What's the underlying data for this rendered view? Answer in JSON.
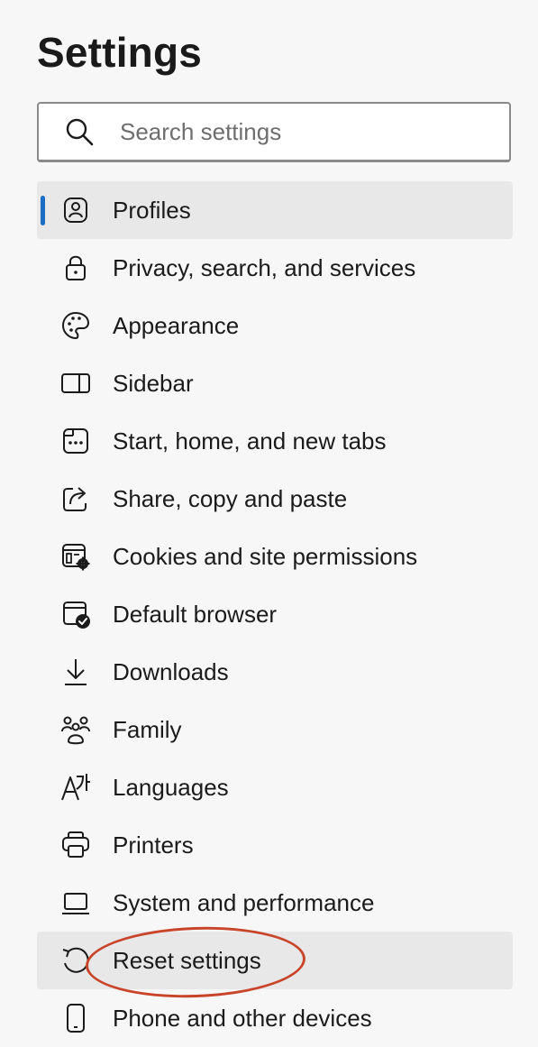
{
  "header": {
    "title": "Settings"
  },
  "search": {
    "placeholder": "Search settings",
    "icon": "search-icon"
  },
  "nav": {
    "items": [
      {
        "label": "Profiles",
        "icon": "profile-icon",
        "state": "selected"
      },
      {
        "label": "Privacy, search, and services",
        "icon": "lock-icon"
      },
      {
        "label": "Appearance",
        "icon": "palette-icon"
      },
      {
        "label": "Sidebar",
        "icon": "sidebar-icon"
      },
      {
        "label": "Start, home, and new tabs",
        "icon": "home-tabs-icon"
      },
      {
        "label": "Share, copy and paste",
        "icon": "share-icon"
      },
      {
        "label": "Cookies and site permissions",
        "icon": "cookies-permissions-icon"
      },
      {
        "label": "Default browser",
        "icon": "default-browser-icon"
      },
      {
        "label": "Downloads",
        "icon": "download-icon"
      },
      {
        "label": "Family",
        "icon": "family-icon"
      },
      {
        "label": "Languages",
        "icon": "languages-icon"
      },
      {
        "label": "Printers",
        "icon": "printer-icon"
      },
      {
        "label": "System and performance",
        "icon": "laptop-icon"
      },
      {
        "label": "Reset settings",
        "icon": "reset-icon",
        "state": "hover",
        "annotated": true
      },
      {
        "label": "Phone and other devices",
        "icon": "phone-icon"
      }
    ]
  },
  "colors": {
    "background": "#f7f7f7",
    "selected_background": "#e8e8e8",
    "accent": "#1a6fc4",
    "annotation": "#c8452a"
  }
}
